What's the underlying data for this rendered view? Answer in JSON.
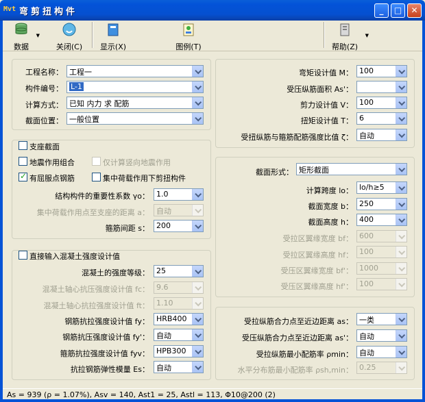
{
  "window": {
    "app_icon": "Mvt",
    "title": "弯剪扭构件"
  },
  "toolbar": {
    "data": "数据",
    "close": "关闭(C)",
    "display": "显示(X)",
    "figure": "图例(T)",
    "help": "帮助(Z)"
  },
  "basic": {
    "project_label": "工程名称：",
    "project_value": "工程一",
    "member_label": "构件编号：",
    "member_value": "L-1",
    "calc_label": "计算方式：",
    "calc_value": "已知 内力 求 配筋",
    "section_label": "截面位置：",
    "section_value": "一般位置"
  },
  "options": {
    "support_section": "支座截面",
    "seismic_combo": "地震作用组合",
    "vertical_seismic": "仅计算竖向地震作用",
    "yield_rebar": "有屈服点钢筋",
    "concentrated_load": "集中荷载作用下剪扭构件",
    "importance_label": "结构构件的重要性系数 γo：",
    "importance_value": "1.0",
    "load_distance_label": "集中荷载作用点至支座的距离 a：",
    "load_distance_value": "自动",
    "stirrup_spacing_label": "箍筋间距 s：",
    "stirrup_spacing_value": "200"
  },
  "concrete": {
    "direct_input": "直接输入混凝土强度设计值",
    "grade_label": "混凝土的强度等级：",
    "grade_value": "25",
    "fc_label": "混凝土轴心抗压强度设计值 fc：",
    "fc_value": "9.6",
    "ft_label": "混凝土轴心抗拉强度设计值 ft：",
    "ft_value": "1.10",
    "fy_label": "钢筋抗拉强度设计值 fy：",
    "fy_value": "HRB400",
    "fyp_label": "钢筋抗压强度设计值 fy'：",
    "fyp_value": "自动",
    "fyv_label": "箍筋抗拉强度设计值 fyv：",
    "fyv_value": "HPB300",
    "es_label": "抗拉钢筋弹性模量 Es：",
    "es_value": "自动"
  },
  "loads": {
    "m_label": "弯矩设计值 M：",
    "m_value": "100",
    "as_label": "受压纵筋面积 As'：",
    "as_value": "",
    "v_label": "剪力设计值 V：",
    "v_value": "100",
    "t_label": "扭矩设计值 T：",
    "t_value": "6",
    "zeta_label": "受扭纵筋与箍筋配筋强度比值 ζ：",
    "zeta_value": "自动"
  },
  "geometry": {
    "shape_label": "截面形式：",
    "shape_value": "矩形截面",
    "span_label": "计算跨度 lo：",
    "span_value": "lo/h≥5",
    "b_label": "截面宽度 b：",
    "b_value": "250",
    "h_label": "截面高度 h：",
    "h_value": "400",
    "bf_label": "受拉区翼缘宽度 bf：",
    "bf_value": "600",
    "hf_label": "受拉区翼缘高度 hf：",
    "hf_value": "100",
    "bfp_label": "受压区翼缘宽度 bf'：",
    "bfp_value": "1000",
    "hfp_label": "受压区翼缘高度 hf'：",
    "hfp_value": "100"
  },
  "rebar": {
    "as_dist_label": "受拉纵筋合力点至近边距离 as：",
    "as_dist_value": "一类",
    "asp_dist_label": "受压纵筋合力点至近边距离 as'：",
    "asp_dist_value": "自动",
    "rho_label": "受拉纵筋最小配筋率 ρmin：",
    "rho_value": "自动",
    "rho_sh_label": "水平分布筋最小配筋率 ρsh,min：",
    "rho_sh_value": "0.25"
  },
  "status": {
    "text": "As = 939 (ρ = 1.07%), Asv = 140, Ast1 = 25, Astl = 113, Φ10@200 (2)"
  }
}
